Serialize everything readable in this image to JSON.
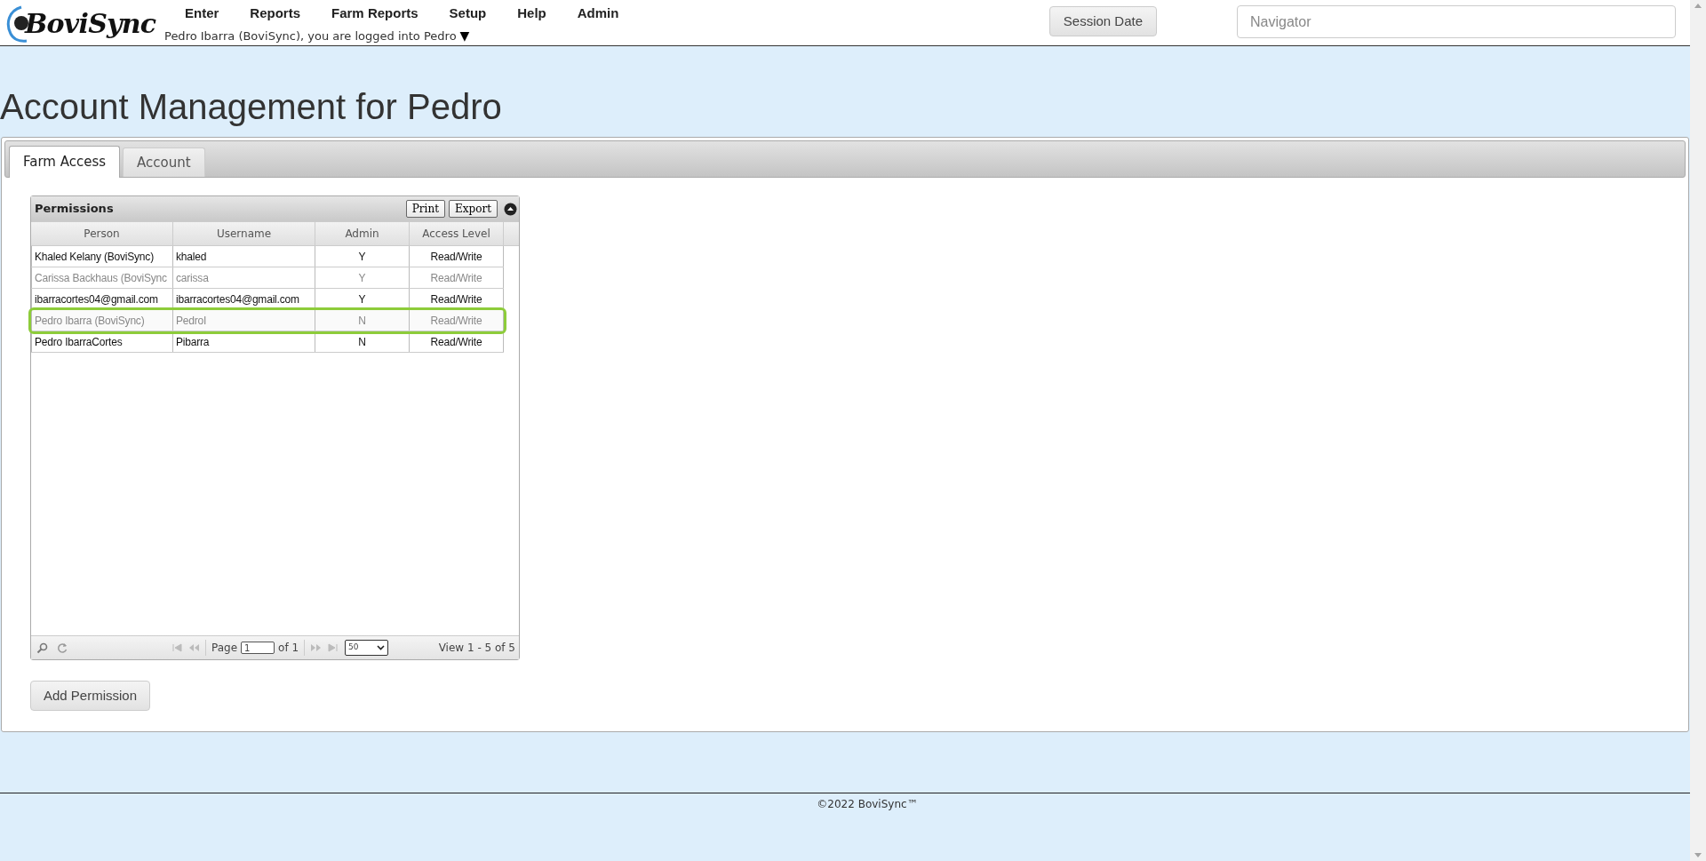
{
  "header": {
    "logo": "BoviSync",
    "menu": [
      "Enter",
      "Reports",
      "Farm Reports",
      "Setup",
      "Help",
      "Admin"
    ],
    "login_text": "Pedro Ibarra (BoviSync), you are logged into Pedro",
    "login_caret": "▼",
    "session_button": "Session Date",
    "navigator": {
      "placeholder": "Navigator"
    }
  },
  "page_title": "Account Management for Pedro",
  "tabs": [
    {
      "label": "Farm Access",
      "selected": true
    },
    {
      "label": "Account",
      "selected": false
    }
  ],
  "grid": {
    "title": "Permissions",
    "buttons": [
      "Print",
      "Export"
    ],
    "columns": [
      "Person",
      "Username",
      "Admin",
      "Access Level"
    ],
    "rows": [
      {
        "cells": [
          "Khaled Kelany (BoviSync)",
          "khaled",
          "Y",
          "Read/Write"
        ],
        "inactive": false,
        "selected": false
      },
      {
        "cells": [
          "Carissa Backhaus (BoviSync",
          "carissa",
          "Y",
          "Read/Write"
        ],
        "inactive": true,
        "selected": false
      },
      {
        "cells": [
          "ibarracortes04@gmail.com",
          "ibarracortes04@gmail.com",
          "Y",
          "Read/Write"
        ],
        "inactive": false,
        "selected": false
      },
      {
        "cells": [
          "Pedro Ibarra (BoviSync)",
          "PedroI",
          "N",
          "Read/Write"
        ],
        "inactive": true,
        "selected": true
      },
      {
        "cells": [
          "Pedro IbarraCortes",
          "Pibarra",
          "N",
          "Read/Write"
        ],
        "inactive": false,
        "selected": false
      }
    ],
    "pager": {
      "page_label": "Page",
      "page_value": "1",
      "of_label": "of 1",
      "page_size": "50",
      "view_text": "View 1 - 5 of 5"
    }
  },
  "add_button": "Add Permission",
  "footer": "©2022 BoviSync™"
}
